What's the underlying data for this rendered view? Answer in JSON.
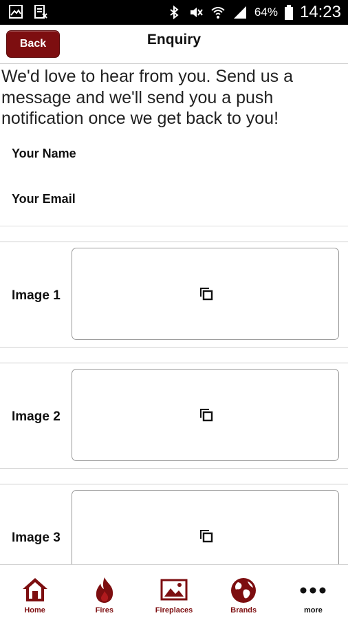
{
  "status_bar": {
    "battery": "64%",
    "time": "14:23",
    "icons": [
      "image-icon",
      "sim-icon",
      "bluetooth-icon",
      "mute-icon",
      "wifi-icon",
      "signal-icon",
      "battery-icon"
    ]
  },
  "header": {
    "back_label": "Back",
    "title": "Enquiry"
  },
  "intro_text": "We'd love to hear from you. Send us a message and we'll send you a push notification once we get back to you!",
  "form": {
    "name_label": "Your Name",
    "email_label": "Your Email",
    "images": [
      {
        "label": "Image 1"
      },
      {
        "label": "Image 2"
      },
      {
        "label": "Image 3"
      }
    ]
  },
  "tab_bar": {
    "tabs": [
      {
        "label": "Home",
        "icon": "home-icon"
      },
      {
        "label": "Fires",
        "icon": "flame-icon"
      },
      {
        "label": "Fireplaces",
        "icon": "picture-icon"
      },
      {
        "label": "Brands",
        "icon": "globe-icon"
      },
      {
        "label": "more",
        "icon": "more-icon"
      }
    ]
  },
  "colors": {
    "accent": "#7d0e10",
    "status_bar": "#000000"
  }
}
